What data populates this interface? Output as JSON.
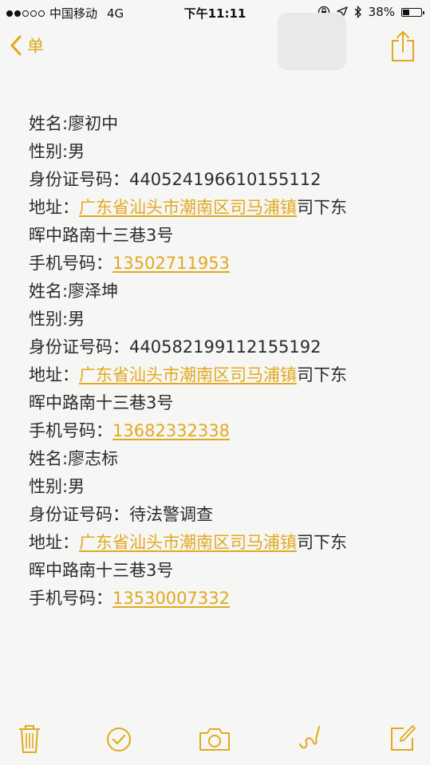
{
  "status_bar": {
    "carrier": "中国移动",
    "network": "4G",
    "time": "下午11:11",
    "battery_percent": "38%",
    "battery_level": 0.38
  },
  "nav": {
    "back_label": "单",
    "accent_color": "#e1a91f"
  },
  "note": {
    "person1": {
      "name": "姓名:廖初中",
      "gender": "性别:男",
      "id_label": "身份证号码：",
      "id_value": "440524196610155112",
      "address_label": "地址：",
      "address_link": "广东省汕头市潮南区司马浦镇",
      "address_rest1": "司下东",
      "address_rest2": "晖中路南十三巷3号",
      "phone_label": "手机号码：",
      "phone_link": "13502711953"
    },
    "person2": {
      "name": "姓名:廖泽坤",
      "gender": "性别:男",
      "id_label": "身份证号码：",
      "id_value": "440582199112155192",
      "address_label": "地址：",
      "address_link": "广东省汕头市潮南区司马浦镇",
      "address_rest1": "司下东",
      "address_rest2": "晖中路南十三巷3号",
      "phone_label": "手机号码：",
      "phone_link": "13682332338"
    },
    "person3": {
      "name": "姓名:廖志标",
      "gender": "性别:男",
      "id_label": "身份证号码：",
      "id_value": "待法警调查",
      "address_label": "地址：",
      "address_link": "广东省汕头市潮南区司马浦镇",
      "address_rest1": "司下东",
      "address_rest2": "晖中路南十三巷3号",
      "phone_label": "手机号码：",
      "phone_link": "13530007332"
    }
  },
  "toolbar": {
    "icons": [
      "trash-icon",
      "checklist-icon",
      "camera-icon",
      "sketch-icon",
      "compose-icon"
    ]
  }
}
